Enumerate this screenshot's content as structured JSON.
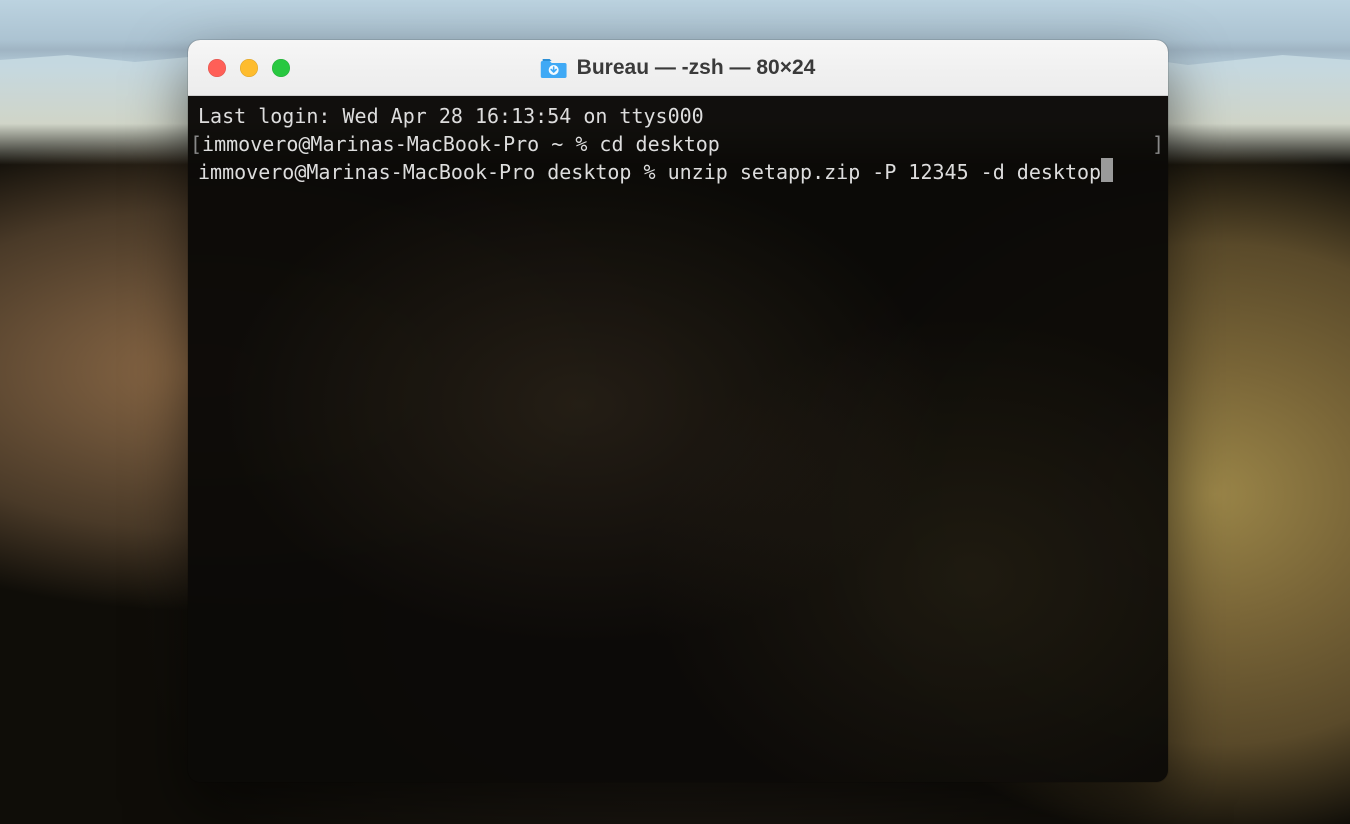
{
  "window": {
    "title": "Bureau — -zsh — 80×24",
    "icon": "folder-downloads-icon"
  },
  "trafficLights": {
    "close": "close",
    "minimize": "minimize",
    "maximize": "maximize"
  },
  "terminal": {
    "lines": {
      "lastLogin": "Last login: Wed Apr 28 16:13:54 on ttys000",
      "prompt1": "immovero@Marinas-MacBook-Pro ~ % cd desktop",
      "prompt2": "immovero@Marinas-MacBook-Pro desktop % unzip setapp.zip -P 12345 -d desktop"
    }
  }
}
